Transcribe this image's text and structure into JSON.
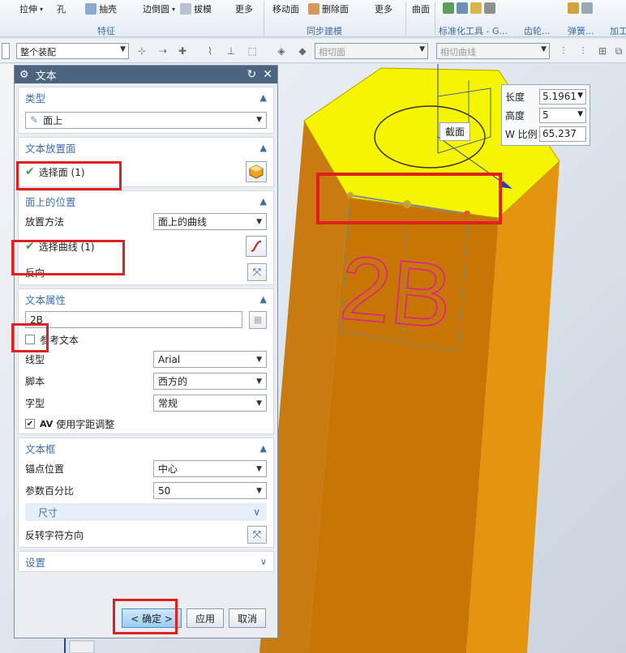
{
  "ribbon": {
    "items": [
      "拉伸",
      "孔",
      "抽壳",
      "边倒圆",
      "拔模",
      "更多",
      "移动面",
      "删除面",
      "更多",
      "曲面",
      "标准化工具 - G...",
      "齿轮...",
      "弹簧...",
      "加工"
    ],
    "groups": {
      "feature": "特征",
      "sync": "同步建模",
      "std": "标准化工具 - G...",
      "gear": "齿轮...",
      "spring": "弹簧...",
      "more": "加工"
    }
  },
  "selbar": {
    "scope": "整个装配",
    "face_rule": "相切面",
    "curve_rule": "相切曲线"
  },
  "dialog": {
    "title": "文本",
    "type": {
      "header": "类型",
      "value": "面上"
    },
    "placement_face": {
      "header": "文本放置面",
      "select_label": "选择面 (1)"
    },
    "position": {
      "header": "面上的位置",
      "method_label": "放置方法",
      "method_value": "面上的曲线",
      "select_curve": "选择曲线 (1)",
      "reverse": "反向"
    },
    "props": {
      "header": "文本属性",
      "text_value": "2B",
      "reference_text": "参考文本",
      "line_label": "线型",
      "line_value": "Arial",
      "script_label": "脚本",
      "script_value": "西方的",
      "style_label": "字型",
      "style_value": "常规",
      "kerning": "使用字距调整"
    },
    "frame": {
      "header": "文本框",
      "anchor_label": "锚点位置",
      "anchor_value": "中心",
      "percent_label": "参数百分比",
      "percent_value": "50",
      "size": "尺寸",
      "reverse_dir": "反转字符方向"
    },
    "settings": {
      "header": "设置"
    },
    "buttons": {
      "ok": "< 确定 >",
      "apply": "应用",
      "cancel": "取消"
    }
  },
  "param": {
    "length_label": "长度",
    "length_value": "5.1961",
    "height_label": "高度",
    "height_value": "5",
    "wratio_label": "W 比例",
    "wratio_value": "65.237"
  },
  "viewport": {
    "section_tag": "截面",
    "text_on_model": "2B"
  },
  "colors": {
    "accent": "#3c6fa8",
    "highlight": "#e02020",
    "top_face": "#f5f500",
    "prism": "#e08800"
  }
}
